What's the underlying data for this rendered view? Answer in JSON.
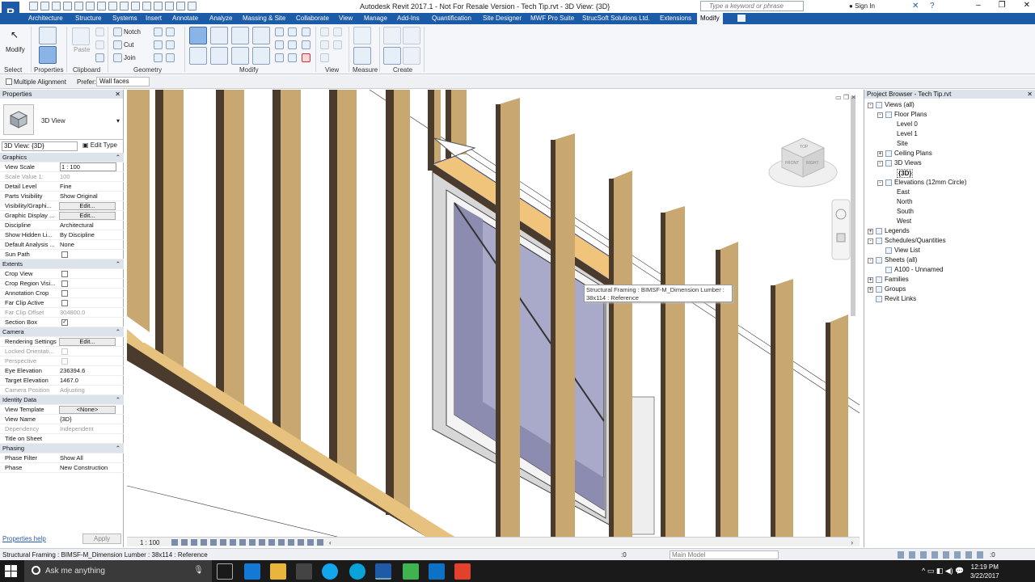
{
  "window": {
    "title": "Autodesk Revit 2017.1 - Not For Resale Version -     Tech Tip.rvt - 3D View: {3D}",
    "search_placeholder": "Type a keyword or phrase",
    "sign_in": "Sign In",
    "logo": "R"
  },
  "ribbon": {
    "tabs": [
      "Architecture",
      "Structure",
      "Systems",
      "Insert",
      "Annotate",
      "Analyze",
      "Massing & Site",
      "Collaborate",
      "View",
      "Manage",
      "Add-Ins",
      "Quantification",
      "Site Designer",
      "MWF Pro Suite",
      "StrucSoft Solutions Ltd.",
      "Extensions",
      "Modify"
    ],
    "active_tab": "Modify",
    "panels": [
      "Select",
      "Properties",
      "Clipboard",
      "Geometry",
      "Modify",
      "View",
      "Measure",
      "Create"
    ],
    "modify_label": "Modify",
    "paste_label": "Paste",
    "notch_label": "Notch",
    "cut_label": "Cut",
    "join_label": "Join"
  },
  "options_bar": {
    "multiple_alignment": "Multiple Alignment",
    "prefer_label": "Prefer:",
    "prefer_value": "Wall faces"
  },
  "properties": {
    "header": "Properties",
    "type_name": "3D View",
    "view_selector": "3D View: {3D}",
    "edit_type": "Edit Type",
    "help": "Properties help",
    "apply": "Apply",
    "rows": [
      {
        "k": "Graphics",
        "kind": "group"
      },
      {
        "k": "View Scale",
        "v": "1 : 100",
        "kind": "input"
      },
      {
        "k": "Scale Value    1:",
        "v": "100",
        "kind": "dis"
      },
      {
        "k": "Detail Level",
        "v": "Fine"
      },
      {
        "k": "Parts Visibility",
        "v": "Show Original"
      },
      {
        "k": "Visibility/Graphi...",
        "v": "Edit...",
        "kind": "btn"
      },
      {
        "k": "Graphic Display ...",
        "v": "Edit...",
        "kind": "btn"
      },
      {
        "k": "Discipline",
        "v": "Architectural"
      },
      {
        "k": "Show Hidden Li...",
        "v": "By Discipline"
      },
      {
        "k": "Default Analysis ...",
        "v": "None"
      },
      {
        "k": "Sun Path",
        "v": "",
        "kind": "chk"
      },
      {
        "k": "Extents",
        "kind": "group"
      },
      {
        "k": "Crop View",
        "v": "",
        "kind": "chk"
      },
      {
        "k": "Crop Region Visi...",
        "v": "",
        "kind": "chk"
      },
      {
        "k": "Annotation Crop",
        "v": "",
        "kind": "chk"
      },
      {
        "k": "Far Clip Active",
        "v": "",
        "kind": "chk"
      },
      {
        "k": "Far Clip Offset",
        "v": "304800.0",
        "kind": "dis"
      },
      {
        "k": "Section Box",
        "v": "✓",
        "kind": "chk"
      },
      {
        "k": "Camera",
        "kind": "group"
      },
      {
        "k": "Rendering Settings",
        "v": "Edit...",
        "kind": "btn"
      },
      {
        "k": "Locked Orientati...",
        "v": "",
        "kind": "dischk"
      },
      {
        "k": "Perspective",
        "v": "",
        "kind": "dischk"
      },
      {
        "k": "Eye Elevation",
        "v": "236394.6"
      },
      {
        "k": "Target Elevation",
        "v": "1467.0"
      },
      {
        "k": "Camera Position",
        "v": "Adjusting",
        "kind": "dis"
      },
      {
        "k": "Identity Data",
        "kind": "group"
      },
      {
        "k": "View Template",
        "v": "<None>",
        "kind": "btn"
      },
      {
        "k": "View Name",
        "v": "{3D}"
      },
      {
        "k": "Dependency",
        "v": "Independent",
        "kind": "dis"
      },
      {
        "k": "Title on Sheet",
        "v": ""
      },
      {
        "k": "Phasing",
        "kind": "group"
      },
      {
        "k": "Phase Filter",
        "v": "Show All"
      },
      {
        "k": "Phase",
        "v": "New Construction"
      }
    ]
  },
  "viewport": {
    "tooltip_line1": "Structural Framing : BIMSF-M_Dimension Lumber :",
    "tooltip_line2": "38x114 : Reference",
    "scale_label": "1 : 100",
    "viewcube_top": "TOP",
    "viewcube_front": "FRONT",
    "viewcube_right": "RIGHT"
  },
  "browser": {
    "header": "Project Browser - Tech Tip.rvt",
    "items": [
      {
        "label": "Views (all)",
        "level": 0,
        "tog": "-"
      },
      {
        "label": "Floor Plans",
        "level": 1,
        "tog": "-"
      },
      {
        "label": "Level 0",
        "level": 2
      },
      {
        "label": "Level 1",
        "level": 2
      },
      {
        "label": "Site",
        "level": 2
      },
      {
        "label": "Ceiling Plans",
        "level": 1,
        "tog": "+"
      },
      {
        "label": "3D Views",
        "level": 1,
        "tog": "-"
      },
      {
        "label": "{3D}",
        "level": 2,
        "bold": true
      },
      {
        "label": "Elevations (12mm Circle)",
        "level": 1,
        "tog": "-"
      },
      {
        "label": "East",
        "level": 2
      },
      {
        "label": "North",
        "level": 2
      },
      {
        "label": "South",
        "level": 2
      },
      {
        "label": "West",
        "level": 2
      },
      {
        "label": "Legends",
        "level": 0,
        "tog": "+"
      },
      {
        "label": "Schedules/Quantities",
        "level": 0,
        "tog": "-"
      },
      {
        "label": "View List",
        "level": 1
      },
      {
        "label": "Sheets (all)",
        "level": 0,
        "tog": "-"
      },
      {
        "label": "A100 - Unnamed",
        "level": 1
      },
      {
        "label": "Families",
        "level": 0,
        "tog": "+"
      },
      {
        "label": "Groups",
        "level": 0,
        "tog": "+"
      },
      {
        "label": "Revit Links",
        "level": 0
      }
    ]
  },
  "status": {
    "text": "Structural Framing : BIMSF-M_Dimension Lumber : 38x114 : Reference",
    "selection_count": ":0",
    "model": "Main Model",
    "filter_count": ":0"
  },
  "taskbar": {
    "search": "Ask me anything",
    "time": "12:19 PM",
    "date": "3/22/2017"
  }
}
